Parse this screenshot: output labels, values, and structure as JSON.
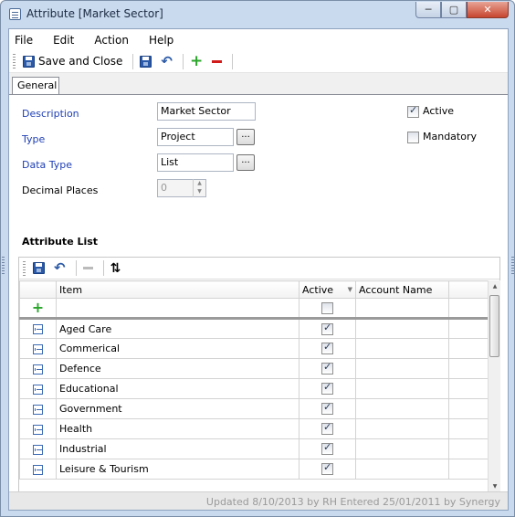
{
  "window": {
    "title": "Attribute [Market Sector]",
    "controls": [
      "─",
      "▢",
      "✕"
    ]
  },
  "menu": {
    "file": "File",
    "edit": "Edit",
    "action": "Action",
    "help": "Help"
  },
  "toolbar": {
    "save_close": "Save and Close"
  },
  "tabs": {
    "general": "General"
  },
  "form": {
    "description_label": "Description",
    "description_value": "Market Sector",
    "type_label": "Type",
    "type_value": "Project",
    "datatype_label": "Data Type",
    "datatype_value": "List",
    "decimal_label": "Decimal Places",
    "decimal_value": "0",
    "ellipsis": "...",
    "active_label": "Active",
    "active_checked": true,
    "mandatory_label": "Mandatory",
    "mandatory_checked": false
  },
  "attribute_list": {
    "title": "Attribute List",
    "columns": {
      "item": "Item",
      "active": "Active",
      "account": "Account Name"
    },
    "rows": [
      {
        "item": "Aged Care",
        "active": true,
        "account": ""
      },
      {
        "item": "Commerical",
        "active": true,
        "account": ""
      },
      {
        "item": "Defence",
        "active": true,
        "account": ""
      },
      {
        "item": "Educational",
        "active": true,
        "account": ""
      },
      {
        "item": "Government",
        "active": true,
        "account": ""
      },
      {
        "item": "Health",
        "active": true,
        "account": ""
      },
      {
        "item": "Industrial",
        "active": true,
        "account": ""
      },
      {
        "item": "Leisure & Tourism",
        "active": true,
        "account": ""
      }
    ]
  },
  "status": {
    "text": "Updated 8/10/2013 by RH  Entered 25/01/2011 by Synergy"
  }
}
